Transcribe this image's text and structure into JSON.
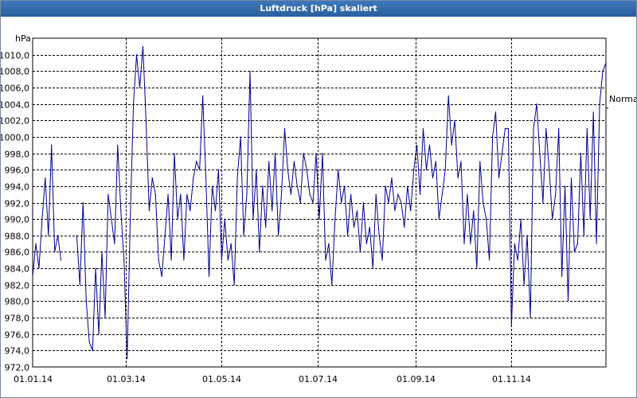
{
  "window": {
    "title": "Luftdruck [hPa] skaliert"
  },
  "colors": {
    "titlebar": "#2a5f9e",
    "series": "#00008b",
    "grid": "#000000",
    "background": "#ffffff"
  },
  "chart_data": {
    "type": "line",
    "title": "Luftdruck [hPa] skaliert",
    "ylabel": "hPa",
    "xlabel": "",
    "ylim": [
      972,
      1012
    ],
    "xlim": [
      "2014-01-01",
      "2014-12-31"
    ],
    "y_ticks": [
      "972,0",
      "974,0",
      "976,0",
      "978,0",
      "980,0",
      "982,0",
      "984,0",
      "986,0",
      "988,0",
      "990,0",
      "992,0",
      "994,0",
      "996,0",
      "998,0",
      "1000,0",
      "1002,0",
      "1004,0",
      "1006,0",
      "1008,0",
      "1010,0"
    ],
    "x_ticks": [
      {
        "date": "2014-01-01",
        "label": "01.01.14"
      },
      {
        "date": "2014-03-01",
        "label": "01.03.14"
      },
      {
        "date": "2014-05-01",
        "label": "01.05.14"
      },
      {
        "date": "2014-07-01",
        "label": "01.07.14"
      },
      {
        "date": "2014-09-01",
        "label": "01.09.14"
      },
      {
        "date": "2014-11-01",
        "label": "01.11.14"
      }
    ],
    "grid": true,
    "reference_line": {
      "label": "Normal",
      "value": 1003.5
    },
    "series": [
      {
        "x": [
          "2014-01-01",
          "2014-01-03",
          "2014-01-05",
          "2014-01-07",
          "2014-01-09",
          "2014-01-11",
          "2014-01-13",
          "2014-01-15",
          "2014-01-17",
          "2014-01-19",
          "2014-01-29",
          "2014-01-31",
          "2014-02-02",
          "2014-02-04",
          "2014-02-06",
          "2014-02-08",
          "2014-02-10",
          "2014-02-12",
          "2014-02-14",
          "2014-02-16",
          "2014-02-18",
          "2014-02-20",
          "2014-02-22",
          "2014-02-24",
          "2014-02-26",
          "2014-02-28",
          "2014-03-02",
          "2014-03-04",
          "2014-03-06",
          "2014-03-08",
          "2014-03-10",
          "2014-03-12",
          "2014-03-14",
          "2014-03-16",
          "2014-03-18",
          "2014-03-20",
          "2014-03-22",
          "2014-03-24",
          "2014-03-26",
          "2014-03-28",
          "2014-03-30",
          "2014-04-01",
          "2014-04-03",
          "2014-04-05",
          "2014-04-07",
          "2014-04-09",
          "2014-04-11",
          "2014-04-13",
          "2014-04-15",
          "2014-04-17",
          "2014-04-19",
          "2014-04-21",
          "2014-04-23",
          "2014-04-25",
          "2014-04-27",
          "2014-04-29",
          "2014-05-01",
          "2014-05-03",
          "2014-05-05",
          "2014-05-07",
          "2014-05-09",
          "2014-05-11",
          "2014-05-13",
          "2014-05-15",
          "2014-05-17",
          "2014-05-19",
          "2014-05-21",
          "2014-05-23",
          "2014-05-25",
          "2014-05-27",
          "2014-05-29",
          "2014-05-31",
          "2014-06-02",
          "2014-06-04",
          "2014-06-06",
          "2014-06-08",
          "2014-06-10",
          "2014-06-12",
          "2014-06-14",
          "2014-06-16",
          "2014-06-18",
          "2014-06-20",
          "2014-06-22",
          "2014-06-24",
          "2014-06-26",
          "2014-06-28",
          "2014-06-30",
          "2014-07-02",
          "2014-07-04",
          "2014-07-06",
          "2014-07-08",
          "2014-07-10",
          "2014-07-12",
          "2014-07-14",
          "2014-07-16",
          "2014-07-18",
          "2014-07-20",
          "2014-07-22",
          "2014-07-24",
          "2014-07-26",
          "2014-07-28",
          "2014-07-30",
          "2014-08-01",
          "2014-08-03",
          "2014-08-05",
          "2014-08-07",
          "2014-08-09",
          "2014-08-11",
          "2014-08-13",
          "2014-08-15",
          "2014-08-17",
          "2014-08-19",
          "2014-08-21",
          "2014-08-23",
          "2014-08-25",
          "2014-08-27",
          "2014-08-29",
          "2014-08-31",
          "2014-09-02",
          "2014-09-04",
          "2014-09-06",
          "2014-09-08",
          "2014-09-10",
          "2014-09-12",
          "2014-09-14",
          "2014-09-16",
          "2014-09-18",
          "2014-09-20",
          "2014-09-22",
          "2014-09-24",
          "2014-09-26",
          "2014-09-28",
          "2014-09-30",
          "2014-10-02",
          "2014-10-04",
          "2014-10-06",
          "2014-10-08",
          "2014-10-10",
          "2014-10-12",
          "2014-10-14",
          "2014-10-16",
          "2014-10-18",
          "2014-10-20",
          "2014-10-22",
          "2014-10-24",
          "2014-10-26",
          "2014-10-28",
          "2014-10-30",
          "2014-11-01",
          "2014-11-03",
          "2014-11-05",
          "2014-11-07",
          "2014-11-09",
          "2014-11-11",
          "2014-11-13",
          "2014-11-15",
          "2014-11-17",
          "2014-11-19",
          "2014-11-21",
          "2014-11-23",
          "2014-11-25",
          "2014-11-27",
          "2014-11-29",
          "2014-12-01",
          "2014-12-03",
          "2014-12-05",
          "2014-12-07",
          "2014-12-09",
          "2014-12-11",
          "2014-12-13",
          "2014-12-15",
          "2014-12-17",
          "2014-12-19",
          "2014-12-21",
          "2014-12-23",
          "2014-12-25",
          "2014-12-27",
          "2014-12-29",
          "2014-12-31"
        ],
        "values": [
          983,
          987,
          984,
          990,
          995,
          988,
          999,
          986,
          988,
          985,
          988,
          982,
          992,
          980,
          975,
          974,
          984,
          976,
          986,
          978,
          993,
          990,
          987,
          999,
          991,
          985,
          973,
          990,
          1004,
          1010,
          1006,
          1011,
          1002,
          991,
          995,
          993,
          985,
          983,
          988,
          993,
          985,
          998,
          990,
          993,
          985,
          993,
          991,
          995,
          997,
          996,
          1005,
          995,
          983,
          994,
          991,
          996,
          985,
          990,
          985,
          987,
          982,
          995,
          1000,
          988,
          993,
          1008,
          990,
          996,
          986,
          994,
          989,
          997,
          991,
          998,
          988,
          993,
          1001,
          996,
          993,
          997,
          994,
          992,
          998,
          996,
          993,
          992,
          998,
          990,
          998,
          985,
          987,
          982,
          990,
          996,
          992,
          994,
          988,
          993,
          989,
          991,
          986,
          992,
          987,
          989,
          984,
          993,
          988,
          985,
          994,
          992,
          995,
          991,
          993,
          992,
          989,
          994,
          991,
          996,
          999,
          993,
          1001,
          996,
          999,
          995,
          997,
          990,
          993,
          996,
          1005,
          999,
          1002,
          995,
          997,
          987,
          993,
          987,
          991,
          984,
          997,
          992,
          990,
          985,
          1000,
          1003,
          995,
          998,
          1001,
          1001,
          977,
          987,
          985,
          990,
          982,
          988,
          978,
          1001,
          1004,
          998,
          992,
          1001,
          996,
          990,
          993,
          1001,
          983,
          994,
          980,
          995,
          986,
          987,
          998,
          988,
          1001,
          990,
          1003,
          987,
          1004,
          1008,
          1009
        ]
      }
    ]
  }
}
